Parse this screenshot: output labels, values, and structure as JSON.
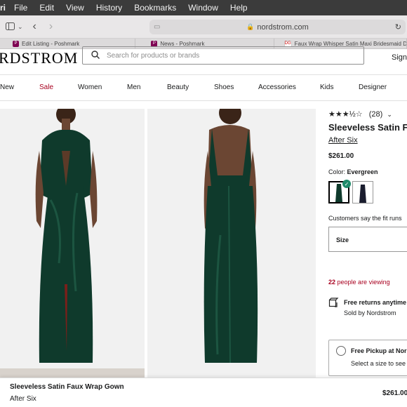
{
  "menubar": {
    "app": "ri",
    "items": [
      "File",
      "Edit",
      "View",
      "History",
      "Bookmarks",
      "Window",
      "Help"
    ]
  },
  "browser": {
    "url": "nordstrom.com"
  },
  "tabs": [
    {
      "label": "Edit Listing - Poshmark",
      "fav": "P"
    },
    {
      "label": "News - Poshmark",
      "fav": "P"
    },
    {
      "label": "Faux Wrap Whisper Satin Maxi Bridesmaid Dress With...",
      "fav": "DG"
    }
  ],
  "header": {
    "logo": "RDSTROM",
    "search_placeholder": "Search for products or brands",
    "signin": "Sign"
  },
  "nav": [
    "New",
    "Sale",
    "Women",
    "Men",
    "Beauty",
    "Shoes",
    "Accessories",
    "Kids",
    "Designer"
  ],
  "product": {
    "rating": "★★★½☆",
    "review_count": "(28)",
    "title": "Sleeveless Satin Fa",
    "brand": "After Six",
    "price": "$261.00",
    "color_label": "Color:",
    "color_value": "Evergreen",
    "fit_text": "Customers say the fit runs",
    "size_label": "Size",
    "viewing_count": "22",
    "viewing_text": "people are viewing",
    "returns_title": "Free returns anytime",
    "sold_by": "Sold by Nordstrom",
    "pickup_title": "Free Pickup at Nor",
    "pickup_sub": "Select a size to see"
  },
  "footer": {
    "title": "Sleeveless Satin Faux Wrap Gown",
    "brand": "After Six",
    "price": "$261.00"
  },
  "colors": {
    "dress": "#0f3a2c",
    "sale_red": "#a8001f",
    "check_green": "#1d8a69"
  }
}
